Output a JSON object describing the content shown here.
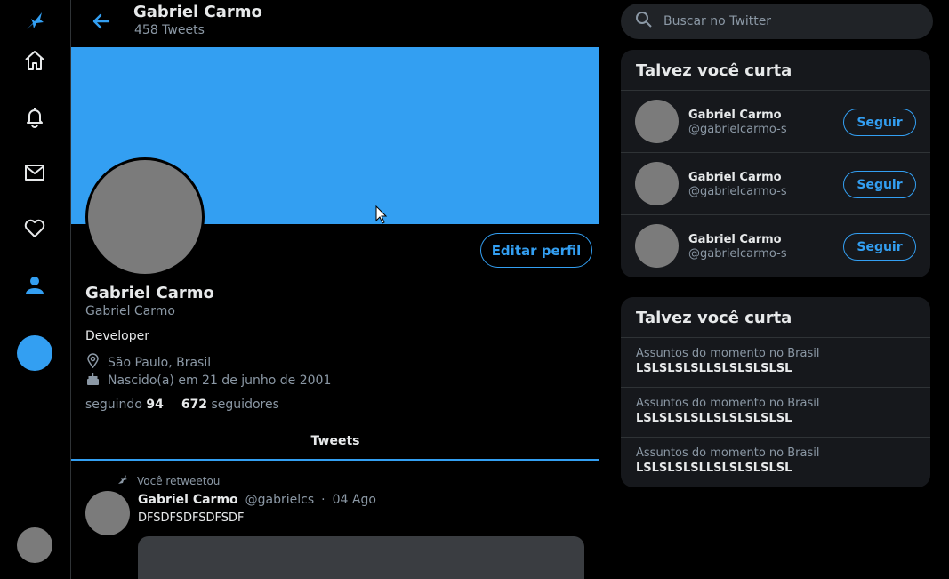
{
  "colors": {
    "accent": "#339ff2",
    "banner": "#339ff2",
    "avatar": "#7b7b7b"
  },
  "nav": {
    "items": [
      {
        "name": "logo-bird-icon"
      },
      {
        "name": "home-icon"
      },
      {
        "name": "bell-icon"
      },
      {
        "name": "mail-icon"
      },
      {
        "name": "heart-icon"
      },
      {
        "name": "user-icon"
      }
    ]
  },
  "header": {
    "name": "Gabriel Carmo",
    "tweet_count": "458 Tweets"
  },
  "profile": {
    "edit_label": "Editar perfil",
    "name": "Gabriel Carmo",
    "handle": "Gabriel Carmo",
    "bio": "Developer",
    "location": "São Paulo, Brasil",
    "birth": "Nascido(a) em 21 de junho de 2001",
    "following_label": "seguindo",
    "following_count": "94",
    "followers_count": "672",
    "followers_label": "seguidores"
  },
  "tabs": {
    "tweets": "Tweets"
  },
  "tweet": {
    "retweet_label": "Você retweetou",
    "author": "Gabriel Carmo",
    "handle": "@gabrielcs",
    "separator": "·",
    "date": "04 Ago",
    "text": "DFSDFSDFSDFSDF"
  },
  "search": {
    "placeholder": "Buscar no Twitter"
  },
  "suggestions": {
    "title": "Talvez você curta",
    "items": [
      {
        "name": "Gabriel Carmo",
        "handle": "@gabrielcarmo-s",
        "button": "Seguir"
      },
      {
        "name": "Gabriel Carmo",
        "handle": "@gabrielcarmo-s",
        "button": "Seguir"
      },
      {
        "name": "Gabriel Carmo",
        "handle": "@gabrielcarmo-s",
        "button": "Seguir"
      }
    ]
  },
  "trends": {
    "title": "Talvez você curta",
    "items": [
      {
        "context": "Assuntos do momento no Brasil",
        "name": "LSLSLSLSLLSLSLSLSLSL"
      },
      {
        "context": "Assuntos do momento no Brasil",
        "name": "LSLSLSLSLLSLSLSLSLSL"
      },
      {
        "context": "Assuntos do momento no Brasil",
        "name": "LSLSLSLSLLSLSLSLSLSL"
      }
    ]
  }
}
